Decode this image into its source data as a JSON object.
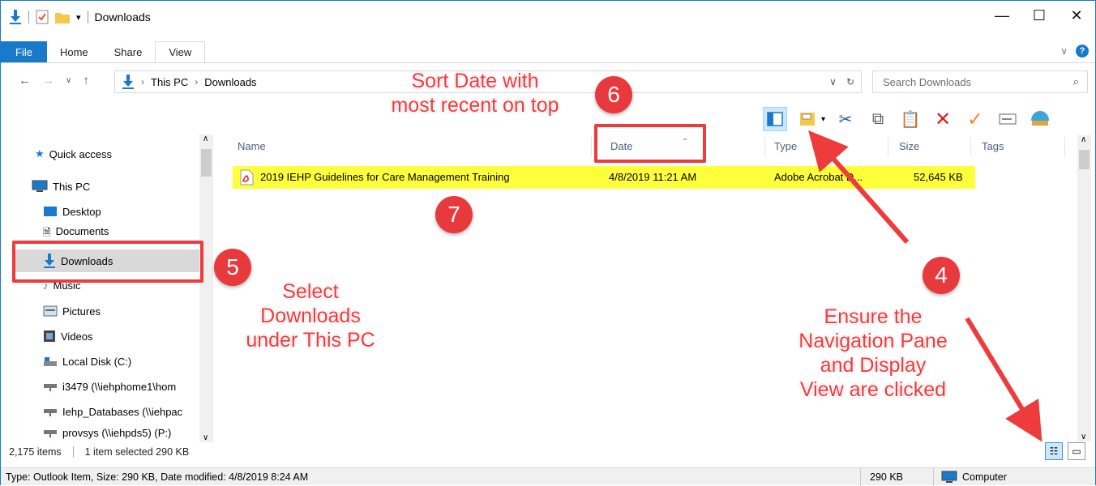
{
  "window": {
    "title": "Downloads"
  },
  "ribbon": {
    "tabs": [
      "File",
      "Home",
      "Share",
      "View"
    ]
  },
  "address": {
    "crumbs": [
      "This PC",
      "Downloads"
    ],
    "search_placeholder": "Search Downloads"
  },
  "nav": {
    "items": [
      {
        "label": "Quick access",
        "icon": "star-icon"
      },
      {
        "label": "This PC",
        "icon": "computer-icon"
      },
      {
        "label": "Desktop",
        "icon": "desktop-icon"
      },
      {
        "label": "Documents",
        "icon": "documents-icon"
      },
      {
        "label": "Downloads",
        "icon": "download-arrow-icon"
      },
      {
        "label": "Music",
        "icon": "music-icon"
      },
      {
        "label": "Pictures",
        "icon": "pictures-icon"
      },
      {
        "label": "Videos",
        "icon": "videos-icon"
      },
      {
        "label": "Local Disk (C:)",
        "icon": "disk-icon"
      },
      {
        "label": "i3479 (\\\\iehphome1\\hom",
        "icon": "network-drive-icon"
      },
      {
        "label": "Iehp_Databases (\\\\iehpac",
        "icon": "network-drive-icon"
      },
      {
        "label": "provsys (\\\\iehpds5) (P:)",
        "icon": "network-drive-icon"
      }
    ]
  },
  "columns": {
    "name": "Name",
    "date": "Date",
    "type": "Type",
    "size": "Size",
    "tags": "Tags"
  },
  "files": [
    {
      "name": "2019 IEHP Guidelines for Care Management Training",
      "date": "4/8/2019 11:21 AM",
      "type": "Adobe Acrobat D...",
      "size": "52,645 KB"
    }
  ],
  "status": {
    "item_count": "2,175 items",
    "selected": "1 item selected  290 KB",
    "detail": "Type: Outlook Item, Size: 290 KB, Date modified: 4/8/2019 8:24 AM",
    "size": "290 KB",
    "location": "Computer"
  },
  "annotations": {
    "step4": "4",
    "step5": "5",
    "step6": "6",
    "step7": "7",
    "sort_note_line1": "Sort Date with",
    "sort_note_line2": "most recent on top",
    "select_line1": "Select",
    "select_line2": "Downloads",
    "select_line3": "under This PC",
    "ensure_line1": "Ensure the",
    "ensure_line2": "Navigation Pane",
    "ensure_line3": "and Display",
    "ensure_line4": "View are clicked"
  },
  "colors": {
    "accent": "#1979ca",
    "highlight": "#ffff3b",
    "annotation": "#ee3b3b"
  }
}
